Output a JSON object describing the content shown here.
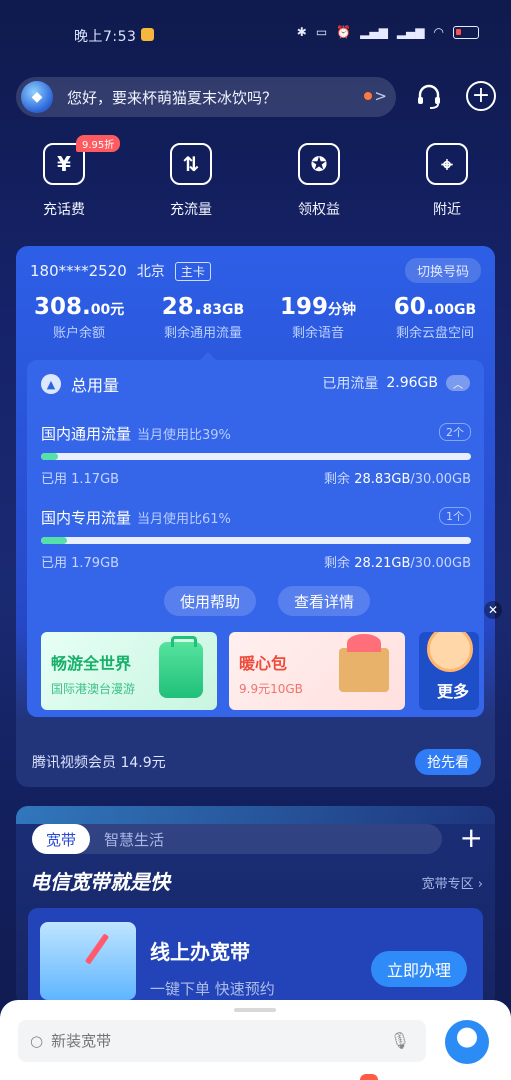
{
  "status_bar": {
    "time": "晚上7:53"
  },
  "greeting": {
    "text": "您好，要来杯萌猫夏末冰饮吗？",
    "chevron": ">"
  },
  "quick_actions": [
    {
      "label": "充话费",
      "icon": "yen-icon",
      "glyph": "¥",
      "badge": "9.95折"
    },
    {
      "label": "充流量",
      "icon": "data-arrows-icon",
      "glyph": "⇅"
    },
    {
      "label": "领权益",
      "icon": "gift-icon",
      "glyph": "✪"
    },
    {
      "label": "附近",
      "icon": "location-pin-icon",
      "glyph": "⌖"
    }
  ],
  "account": {
    "phone": "180****2520",
    "city": "北京",
    "tag": "主卡",
    "switch_label": "切换号码",
    "stats": [
      {
        "value": "308.",
        "decimal": "00",
        "unit": "元",
        "label": "账户余额"
      },
      {
        "value": "28.",
        "decimal": "83",
        "unit": "GB",
        "label": "剩余通用流量"
      },
      {
        "value": "199",
        "decimal": "",
        "unit": "分钟",
        "label": "剩余语音"
      },
      {
        "value": "60.",
        "decimal": "00",
        "unit": "GB",
        "label": "剩余云盘空间"
      }
    ]
  },
  "usage": {
    "title": "总用量",
    "used_label": "已用流量",
    "used_value": "2.96GB",
    "blocks": [
      {
        "title": "国内通用流量",
        "ratio": "当月使用比39%",
        "count": "2个",
        "used": "已用 1.17GB",
        "left_label": "剩余",
        "left_value": "28.83GB",
        "total": "/30.00GB",
        "fill": 0.039
      },
      {
        "title": "国内专用流量",
        "ratio": "当月使用比61%",
        "count": "1个",
        "used": "已用 1.79GB",
        "left_label": "剩余",
        "left_value": "28.21GB",
        "total": "/30.00GB",
        "fill": 0.06
      }
    ],
    "help_label": "使用帮助",
    "detail_label": "查看详情"
  },
  "promos": [
    {
      "title": "畅游全世界",
      "sub": "国际港澳台漫游"
    },
    {
      "title": "暖心包",
      "sub": "9.9元10GB"
    }
  ],
  "more_label": "更多",
  "promo_footer": {
    "text": "腾讯视频会员 14.9元",
    "button": "抢先看"
  },
  "broadband": {
    "tab_active": "宽带",
    "tab_other": "智慧生活",
    "slogan": "电信宽带就是快",
    "zone": "宽带专区 ›",
    "title": "线上办宽带",
    "sub": "一键下单  快速预约",
    "cta": "立即办理"
  },
  "search": {
    "placeholder": "新装宽带"
  },
  "colors": {
    "accent": "#2f7cf6",
    "progress": "#55e0a7",
    "badge": "#ff5a5f"
  }
}
